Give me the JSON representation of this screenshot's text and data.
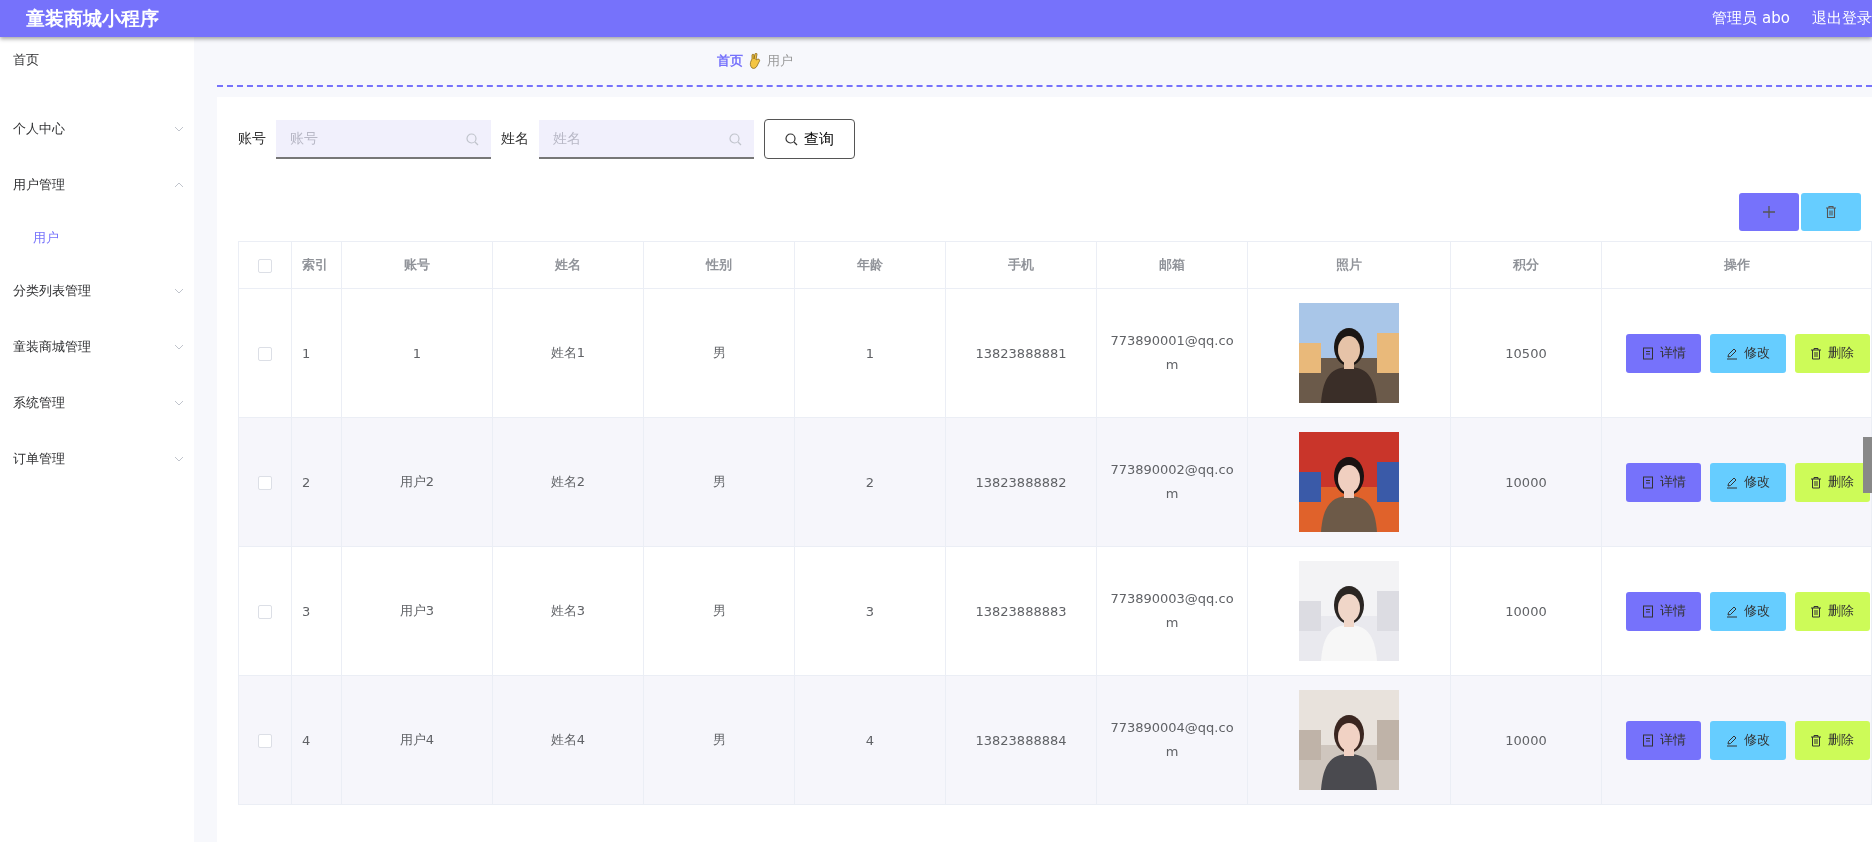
{
  "header": {
    "title": "童装商城小程序",
    "user": "管理员 abo",
    "logout": "退出登录"
  },
  "sidebar": {
    "items": [
      {
        "label": "首页"
      },
      {
        "label": "个人中心",
        "expanded": false
      },
      {
        "label": "用户管理",
        "expanded": true,
        "children": [
          {
            "label": "用户",
            "selected": true
          }
        ]
      },
      {
        "label": "分类列表管理",
        "expanded": false
      },
      {
        "label": "童装商城管理",
        "expanded": false
      },
      {
        "label": "系统管理",
        "expanded": false
      },
      {
        "label": "订单管理",
        "expanded": false
      }
    ]
  },
  "breadcrumb": [
    "首页",
    "用户"
  ],
  "search": {
    "fields": [
      {
        "label": "账号",
        "placeholder": "账号"
      },
      {
        "label": "姓名",
        "placeholder": "姓名"
      }
    ],
    "button": "查询"
  },
  "table": {
    "all_checked": false,
    "columns": [
      "索引",
      "账号",
      "姓名",
      "性别",
      "年龄",
      "手机",
      "邮箱",
      "照片",
      "积分",
      "操作"
    ],
    "rows": [
      {
        "checked": false,
        "cells": [
          "1",
          "1",
          "姓名1",
          "男",
          "1",
          "13823888881",
          "773890001@qq.com"
        ],
        "photo": {
          "kind": "picture"
        },
        "points": "10500",
        "actions": [
          "详情",
          "修改",
          "删除"
        ]
      },
      {
        "checked": false,
        "cells": [
          "2",
          "用户2",
          "姓名2",
          "男",
          "2",
          "13823888882",
          "773890002@qq.com"
        ],
        "photo": {
          "kind": "picture"
        },
        "points": "10000",
        "actions": [
          "详情",
          "修改",
          "删除"
        ]
      },
      {
        "checked": false,
        "cells": [
          "3",
          "用户3",
          "姓名3",
          "男",
          "3",
          "13823888883",
          "773890003@qq.com"
        ],
        "photo": {
          "kind": "picture"
        },
        "points": "10000",
        "actions": [
          "详情",
          "修改",
          "删除"
        ]
      },
      {
        "checked": false,
        "cells": [
          "4",
          "用户4",
          "姓名4",
          "男",
          "4",
          "13823888884",
          "773890004@qq.com"
        ],
        "photo": {
          "kind": "picture"
        },
        "points": "10000",
        "actions": [
          "详情",
          "修改",
          "删除"
        ]
      }
    ]
  }
}
